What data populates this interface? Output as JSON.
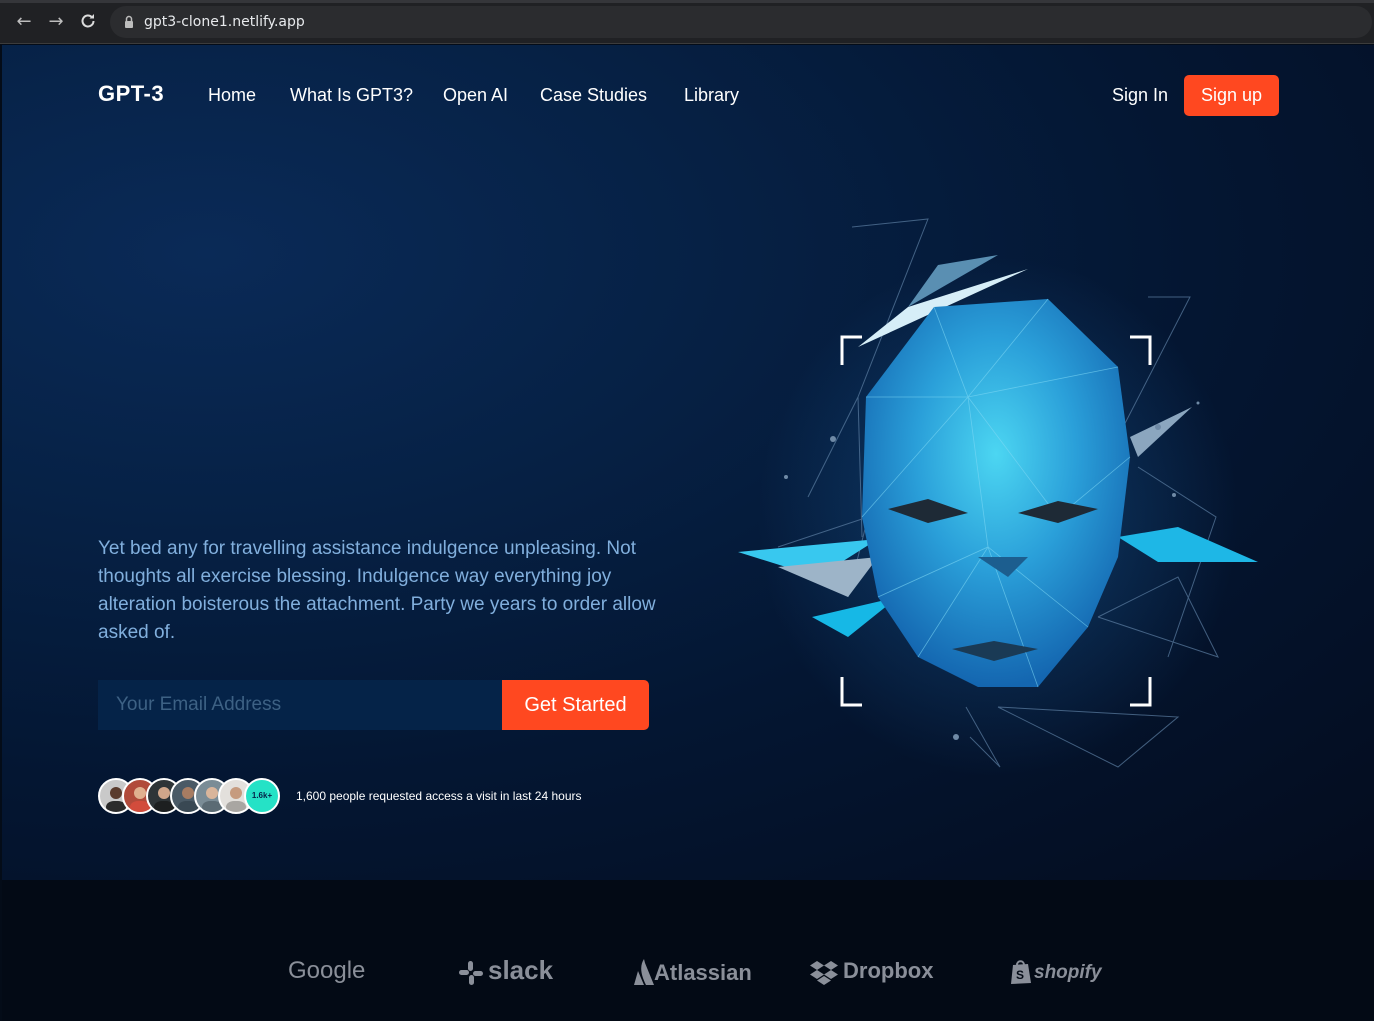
{
  "browser": {
    "url": "gpt3-clone1.netlify.app",
    "back_icon": "arrow-left-icon",
    "forward_icon": "arrow-right-icon",
    "reload_icon": "reload-icon"
  },
  "navbar": {
    "logo": "GPT-3",
    "links": [
      "Home",
      "What Is GPT3?",
      "Open AI",
      "Case Studies",
      "Library"
    ],
    "sign_in": "Sign In",
    "sign_up": "Sign up"
  },
  "hero": {
    "description": "Yet bed any for travelling assistance indulgence unpleasing. Not thoughts all exercise blessing. Indulgence way everything joy alteration boisterous the attachment. Party we years to order allow asked of.",
    "email_placeholder": "Your Email Address",
    "cta": "Get Started",
    "avatar_count": "1.6k+",
    "access_text": "1,600 people requested access a visit in last 24 hours"
  },
  "brands": [
    "Google",
    "slack",
    "Atlassian",
    "Dropbox",
    "shopify"
  ],
  "colors": {
    "accent": "#ff4820",
    "text_muted": "#81afdd",
    "avatar_badge": "#25e2c6"
  }
}
